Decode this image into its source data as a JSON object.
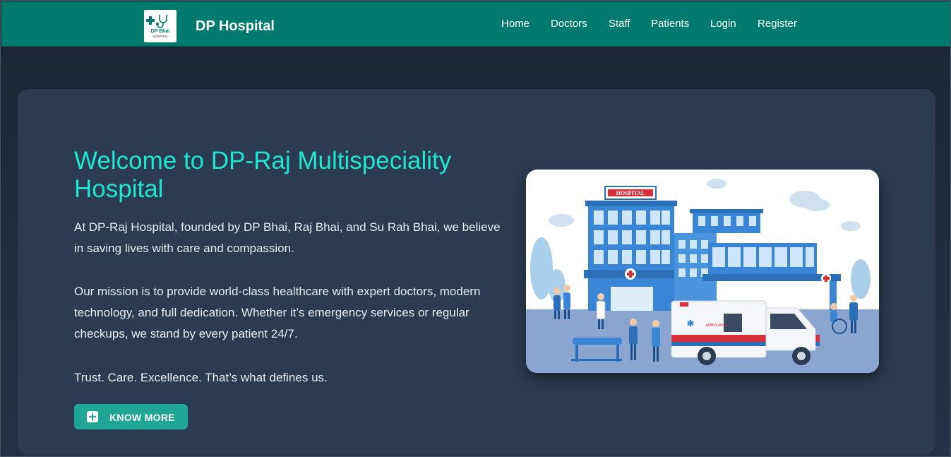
{
  "navbar": {
    "brand": "DP Hospital",
    "logo_text_line1": "DP Bhai",
    "logo_text_line2": "HOSPITAL",
    "links": [
      "Home",
      "Doctors",
      "Staff",
      "Patients",
      "Login",
      "Register"
    ]
  },
  "hero": {
    "title": "Welcome to DP-Raj Multispeciality Hospital",
    "paragraphs": [
      "At DP-Raj Hospital, founded by DP Bhai, Raj Bhai, and Su Rah Bhai, we believe in saving lives with care and compassion.",
      "Our mission is to provide world-class healthcare with expert doctors, modern technology, and full dedication. Whether it’s emergency services or regular checkups, we stand by every patient 24/7.",
      "Trust. Care. Excellence. That’s what defines us."
    ],
    "button_label": "KNOW MORE",
    "button_icon": "plus-square-icon",
    "illustration": {
      "hospital_sign": "HOSPITAL",
      "ambulance_label": "AMBULANCE"
    }
  },
  "colors": {
    "navbar": "#007a6f",
    "accent": "#1ee6d0",
    "button": "#1fa696",
    "card": "#2b3b52",
    "background": "#1f2a3d"
  }
}
